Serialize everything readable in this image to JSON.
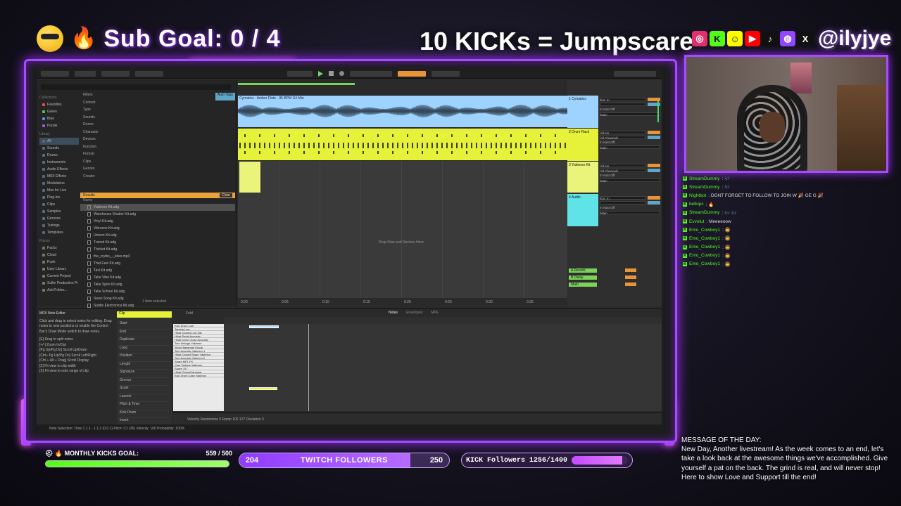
{
  "overlay": {
    "sub_goal": "Sub Goal:  0 / 4",
    "kicks_banner": "10 KICKs = Jumpscare",
    "handle": "@ilyjye",
    "socials": [
      {
        "name": "instagram-icon",
        "glyph": "◎",
        "color": "#e1306c"
      },
      {
        "name": "kick-icon",
        "glyph": "K",
        "color": "#53fc18"
      },
      {
        "name": "snapchat-icon",
        "glyph": "☺",
        "color": "#fffc00"
      },
      {
        "name": "youtube-icon",
        "glyph": "▶",
        "color": "#ff0000"
      },
      {
        "name": "tiktok-icon",
        "glyph": "♪",
        "color": "#111111"
      },
      {
        "name": "twitch-icon",
        "glyph": "◍",
        "color": "#9146ff"
      },
      {
        "name": "x-icon",
        "glyph": "X",
        "color": "#111111"
      }
    ]
  },
  "daw": {
    "browser": {
      "collections_label": "Collections",
      "collections": [
        {
          "label": "Favorites",
          "color": "#e05050"
        },
        {
          "label": "Green",
          "color": "#50c050"
        },
        {
          "label": "Blue",
          "color": "#5090e0"
        },
        {
          "label": "Purple",
          "color": "#a050e0"
        }
      ],
      "library_label": "Library",
      "library": [
        "All",
        "Sounds",
        "Drums",
        "Instruments",
        "Audio Effects",
        "MIDI Effects",
        "Modulators",
        "Max for Live",
        "Plug-ins",
        "Clips",
        "Samples",
        "Grooves",
        "Tunings",
        "Templates"
      ],
      "places_label": "Places",
      "places": [
        "Packs",
        "Cloud",
        "Push",
        "User Library",
        "Current Project",
        "Sullie Production Pr",
        "Add Folder..."
      ],
      "filters_label": "Filters",
      "auto_tags": "Auto Tags",
      "filters": [
        "Content",
        "Type",
        "Sounds",
        "Drums",
        "Character",
        "Devices",
        "Function",
        "Format",
        "Clips",
        "Genres",
        "Creator"
      ],
      "results_label": "Results",
      "clear_label": "Clear",
      "name_label": "Name",
      "results": [
        "Yakimon Kit.adg",
        "Warehouse Shatter Kit.adg",
        "Vinyl Kit.adg",
        "Vibrance Kit.adg",
        "Unison Kit.adg",
        "Transit Kit.adg",
        "Thicket Kit.adg",
        "the_crybis_-_kites.mp3",
        "That Feel Kit.adg",
        "Taxi Kit.adg",
        "Take Vibe Kit.adg",
        "Take Spire Kit.adg",
        "Take School Kit.adg",
        "Swan Song Kit.adg",
        "Subtle Electronica Kit.adg"
      ],
      "status": "1 Item selected"
    },
    "tracks": [
      {
        "name": "1 Cymatics",
        "clip": "Cymatics - Amber Flute - 95 BPM G# Min",
        "color": "#9fd3ff"
      },
      {
        "name": "2 Drum Rack",
        "clip": "",
        "color": "#e6f23a"
      },
      {
        "name": "3 Yakimon Kit",
        "clip": "",
        "color": "#eaf47a"
      },
      {
        "name": "4 Audio",
        "clip": "",
        "color": "#5fe3e6"
      }
    ],
    "io": {
      "ext_in": "Ext. In",
      "all_ins": "All Ins",
      "all_channels": "All Channels",
      "auto": "In  Auto  Off",
      "main": "Main"
    },
    "returns": [
      {
        "name": "A Reverb",
        "color": "#7dd35a"
      },
      {
        "name": "B Delay",
        "color": "#7dd35a"
      },
      {
        "name": "Main",
        "color": "#7dd35a"
      }
    ],
    "drop_text": "Drop Files and Devices Here",
    "time_marks": [
      "0:00",
      "0:05",
      "0:10",
      "0:15",
      "0:20",
      "0:25",
      "0:30",
      "0:35"
    ],
    "detail": {
      "info_title": "MIDI Note Editor",
      "info_text": "Click and drag to select notes for editing. Drag notes to new positions or enable the Control Bar's Draw Mode switch to draw notes.",
      "shortcuts": [
        "[E] Drag to split notes",
        "[+/-] Zoom In/Out",
        "[Pg Up/Pg Dn] Scroll Up/Down",
        "[Ctrl+ Pg Up/Pg Dn] Scroll Left/Right",
        "[Ctrl + Alt + Drag] Scroll Display",
        "[Z] Fit view to clip width",
        "[X] Fit view to note range of clip"
      ],
      "clip_tab": "Clip",
      "fold": "Fold",
      "tabs": [
        "Notes",
        "Envelopes",
        "MPE"
      ],
      "clip_fields": [
        "Start",
        "End",
        "Duplicate",
        "Loop",
        "Position",
        "Length",
        "Signature",
        "Groove",
        "Scale",
        "Launch",
        "Pitch & Time",
        "Kick Drum",
        "Invert"
      ],
      "keys": [
        "Kick Drum Low",
        "Tambla Low",
        "Hihat Closed Low Zils",
        "Hihat Pedal Acoustic",
        "Hihat Open Close Acoustic",
        "Tom Vintage Yakimon",
        "Wood Bassman Knock",
        "Tom Acoustic Yakimon 1",
        "Hihat Closed Sharp Yakimon",
        "Tom Acoustic Yakimon 2",
        "Snare MPL FX",
        "Clap Vintage Yakimon",
        "Snare 707",
        "Hihat Closed Modular",
        "Kick Drum Case Yakimon"
      ],
      "velocity_row": "Velocity  Randomize  0  Ramp  100  127  Deviation  0",
      "status": "Note Selection: Time 1.1.1 - 1.1.3 (0.0.1)  Pitch: C1 (36)  Velocity: 100  Probability: 100%"
    }
  },
  "chat": [
    {
      "name": "StreamDummy",
      "msg": ": 🎶"
    },
    {
      "name": "StreamDummy",
      "msg": ": 🎶"
    },
    {
      "name": "Nightbot",
      "msg": ": DONT FORGET TO FOLLOW TO JOIN W 🎉 GE G 🎉"
    },
    {
      "name": "bellopc",
      "msg": ": 🔥"
    },
    {
      "name": "StreamDummy",
      "msg": ": 🎶 🎶"
    },
    {
      "name": "Evvolut",
      "msg": ": Meeeeoow"
    },
    {
      "name": "Emo_Cowboy1",
      "msg": ": 🤠"
    },
    {
      "name": "Emo_Cowboy1",
      "msg": ": 🤠"
    },
    {
      "name": "Emo_Cowboy1",
      "msg": ": 🤠"
    },
    {
      "name": "Emo_Cowboy1",
      "msg": ": 🤠"
    },
    {
      "name": "Emo_Cowboy1",
      "msg": ": 🤠"
    }
  ],
  "motd": {
    "title": "MESSAGE OF THE DAY:",
    "body": "New Day, Another livestream! As the week comes to an end, let's take a look back at the awesome things we've accomplished. Give yourself a pat on the back. The grind is real, and will never stop! Here to show Love and Support till the end!"
  },
  "goals": {
    "monthly_label": "MONTHLY KICKS GOAL:",
    "monthly_value": "559 / 500",
    "monthly_progress": 1.0,
    "twitch_current": "204",
    "twitch_label": "TWITCH FOLLOWERS",
    "twitch_target": "250",
    "twitch_progress": 0.816,
    "kick_label": "KICK Followers 1256/1400",
    "kick_progress": 0.897
  },
  "colors": {
    "accent": "#a74bff",
    "kick_green": "#53fc18",
    "twitch_purple": "#9146ff"
  }
}
